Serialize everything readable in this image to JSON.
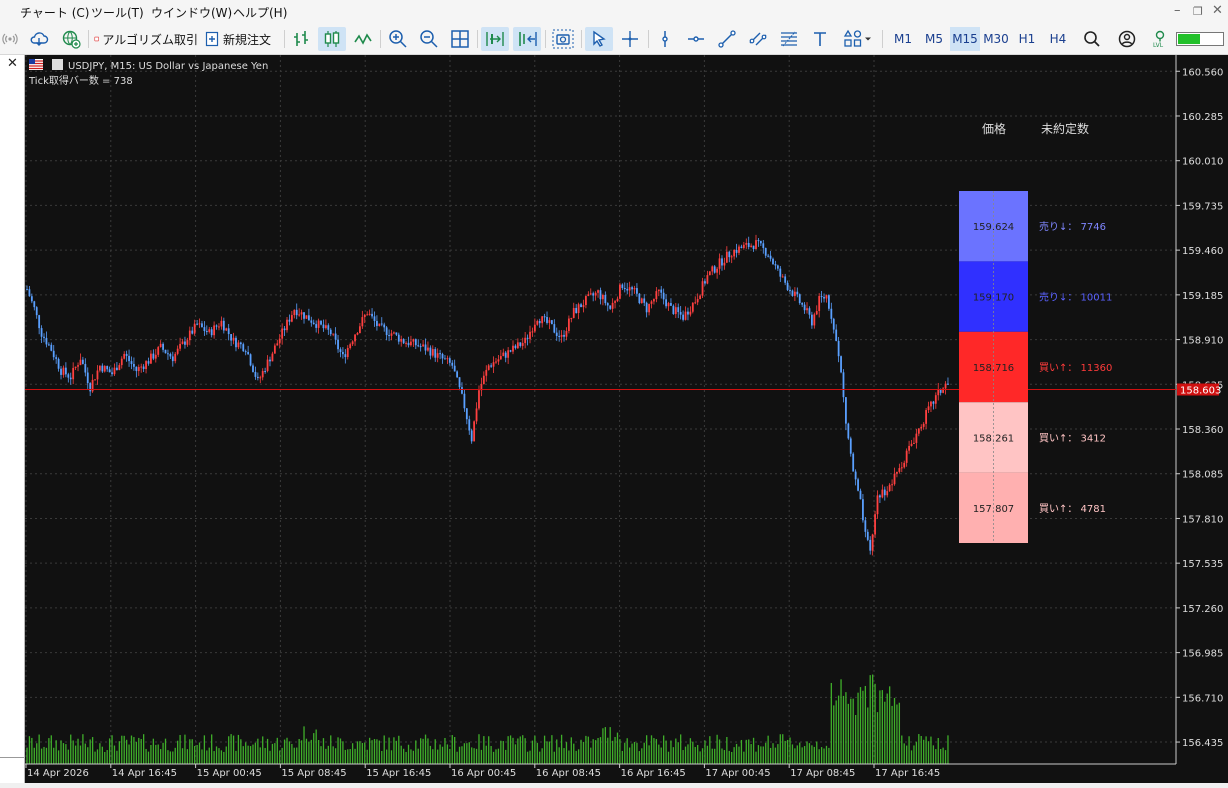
{
  "menu": {
    "items": [
      "チャート (C)",
      "ツール(T)",
      "ウインドウ(W)",
      "ヘルプ(H)"
    ]
  },
  "window_controls": {
    "minimize": "–",
    "restore": "❐",
    "close": "✕"
  },
  "toolbar": {
    "algo_trading_label": "アルゴリズム取引",
    "new_order_label": "新規注文",
    "timeframes": [
      "M1",
      "M5",
      "M15",
      "M30",
      "H1",
      "H4"
    ],
    "active_timeframe": "M15"
  },
  "left_panel": {
    "close_glyph": "✕"
  },
  "chart": {
    "symbol_info": "USDJPY, M15:  US Dollar vs Japanese Yen",
    "tick_info": "Tick取得バー数 = 738",
    "current_price": "158.603",
    "colors": {
      "background": "#111111",
      "candle_bull": "#ff4040",
      "candle_bear": "#5aa0ff",
      "volume": "#3fae2a",
      "current_line": "#d01010",
      "grid": "#3a3a3a"
    }
  },
  "order_book": {
    "header_price": "価格",
    "header_oi": "未約定数",
    "levels": [
      {
        "price": "159.624",
        "label": "売り↓：",
        "count": "7746",
        "fill": "#6b73ff",
        "text_color": "#7f86ff"
      },
      {
        "price": "159.170",
        "label": "売り↓：",
        "count": "10011",
        "fill": "#3030ff",
        "text_color": "#5a61ff"
      },
      {
        "price": "158.716",
        "label": "買い↑：",
        "count": "11360",
        "fill": "#ff2828",
        "text_color": "#ff3b3b"
      },
      {
        "price": "158.261",
        "label": "買い↑：",
        "count": "3412",
        "fill": "#ffc4c4",
        "text_color": "#ffc4c4"
      },
      {
        "price": "157.807",
        "label": "買い↑：",
        "count": "4781",
        "fill": "#ffb0b0",
        "text_color": "#ffc4c4"
      }
    ]
  },
  "chart_data": {
    "type": "candlestick",
    "symbol": "USDJPY",
    "timeframe": "M15",
    "y_ticks": [
      "160.560",
      "160.285",
      "160.010",
      "159.735",
      "159.460",
      "159.185",
      "158.910",
      "158.635",
      "158.360",
      "158.085",
      "157.810",
      "157.535",
      "157.260",
      "156.985",
      "156.710",
      "156.435"
    ],
    "x_ticks": [
      "14 Apr 2026",
      "14 Apr 16:45",
      "15 Apr 00:45",
      "15 Apr 08:45",
      "15 Apr 16:45",
      "16 Apr 00:45",
      "16 Apr 08:45",
      "16 Apr 16:45",
      "17 Apr 00:45",
      "17 Apr 08:45",
      "17 Apr 16:45"
    ],
    "ylim": [
      156.3,
      160.66
    ],
    "price_path": [
      [
        0,
        159.22
      ],
      [
        3,
        159.1
      ],
      [
        6,
        158.95
      ],
      [
        10,
        158.85
      ],
      [
        14,
        158.72
      ],
      [
        18,
        158.68
      ],
      [
        22,
        158.8
      ],
      [
        26,
        158.62
      ],
      [
        30,
        158.75
      ],
      [
        35,
        158.7
      ],
      [
        40,
        158.82
      ],
      [
        45,
        158.72
      ],
      [
        50,
        158.78
      ],
      [
        55,
        158.86
      ],
      [
        60,
        158.8
      ],
      [
        65,
        158.9
      ],
      [
        70,
        159.0
      ],
      [
        75,
        158.95
      ],
      [
        80,
        159.02
      ],
      [
        85,
        158.9
      ],
      [
        90,
        158.86
      ],
      [
        95,
        158.65
      ],
      [
        100,
        158.8
      ],
      [
        105,
        158.95
      ],
      [
        110,
        159.1
      ],
      [
        115,
        159.05
      ],
      [
        120,
        159.0
      ],
      [
        125,
        158.95
      ],
      [
        130,
        158.8
      ],
      [
        135,
        158.95
      ],
      [
        140,
        159.08
      ],
      [
        145,
        158.98
      ],
      [
        150,
        158.95
      ],
      [
        155,
        158.9
      ],
      [
        160,
        158.88
      ],
      [
        165,
        158.85
      ],
      [
        170,
        158.8
      ],
      [
        175,
        158.75
      ],
      [
        180,
        158.5
      ],
      [
        183,
        158.3
      ],
      [
        186,
        158.6
      ],
      [
        190,
        158.75
      ],
      [
        195,
        158.8
      ],
      [
        200,
        158.85
      ],
      [
        205,
        158.9
      ],
      [
        210,
        159.05
      ],
      [
        215,
        159.0
      ],
      [
        220,
        158.92
      ],
      [
        225,
        159.08
      ],
      [
        230,
        159.15
      ],
      [
        235,
        159.2
      ],
      [
        240,
        159.1
      ],
      [
        245,
        159.25
      ],
      [
        250,
        159.2
      ],
      [
        255,
        159.1
      ],
      [
        260,
        159.2
      ],
      [
        265,
        159.1
      ],
      [
        270,
        159.05
      ],
      [
        275,
        159.15
      ],
      [
        280,
        159.3
      ],
      [
        285,
        159.38
      ],
      [
        290,
        159.45
      ],
      [
        295,
        159.48
      ],
      [
        300,
        159.5
      ],
      [
        305,
        159.44
      ],
      [
        310,
        159.3
      ],
      [
        315,
        159.2
      ],
      [
        320,
        159.1
      ],
      [
        323,
        159.02
      ],
      [
        326,
        159.15
      ],
      [
        329,
        159.18
      ],
      [
        332,
        159.0
      ],
      [
        335,
        158.7
      ],
      [
        337,
        158.4
      ],
      [
        340,
        158.1
      ],
      [
        343,
        157.9
      ],
      [
        345,
        157.7
      ],
      [
        347,
        157.6
      ],
      [
        350,
        157.95
      ],
      [
        355,
        158.0
      ],
      [
        360,
        158.15
      ],
      [
        365,
        158.3
      ],
      [
        370,
        158.45
      ],
      [
        375,
        158.58
      ],
      [
        378,
        158.63
      ]
    ],
    "overlay": "order book price levels with open order counts"
  }
}
